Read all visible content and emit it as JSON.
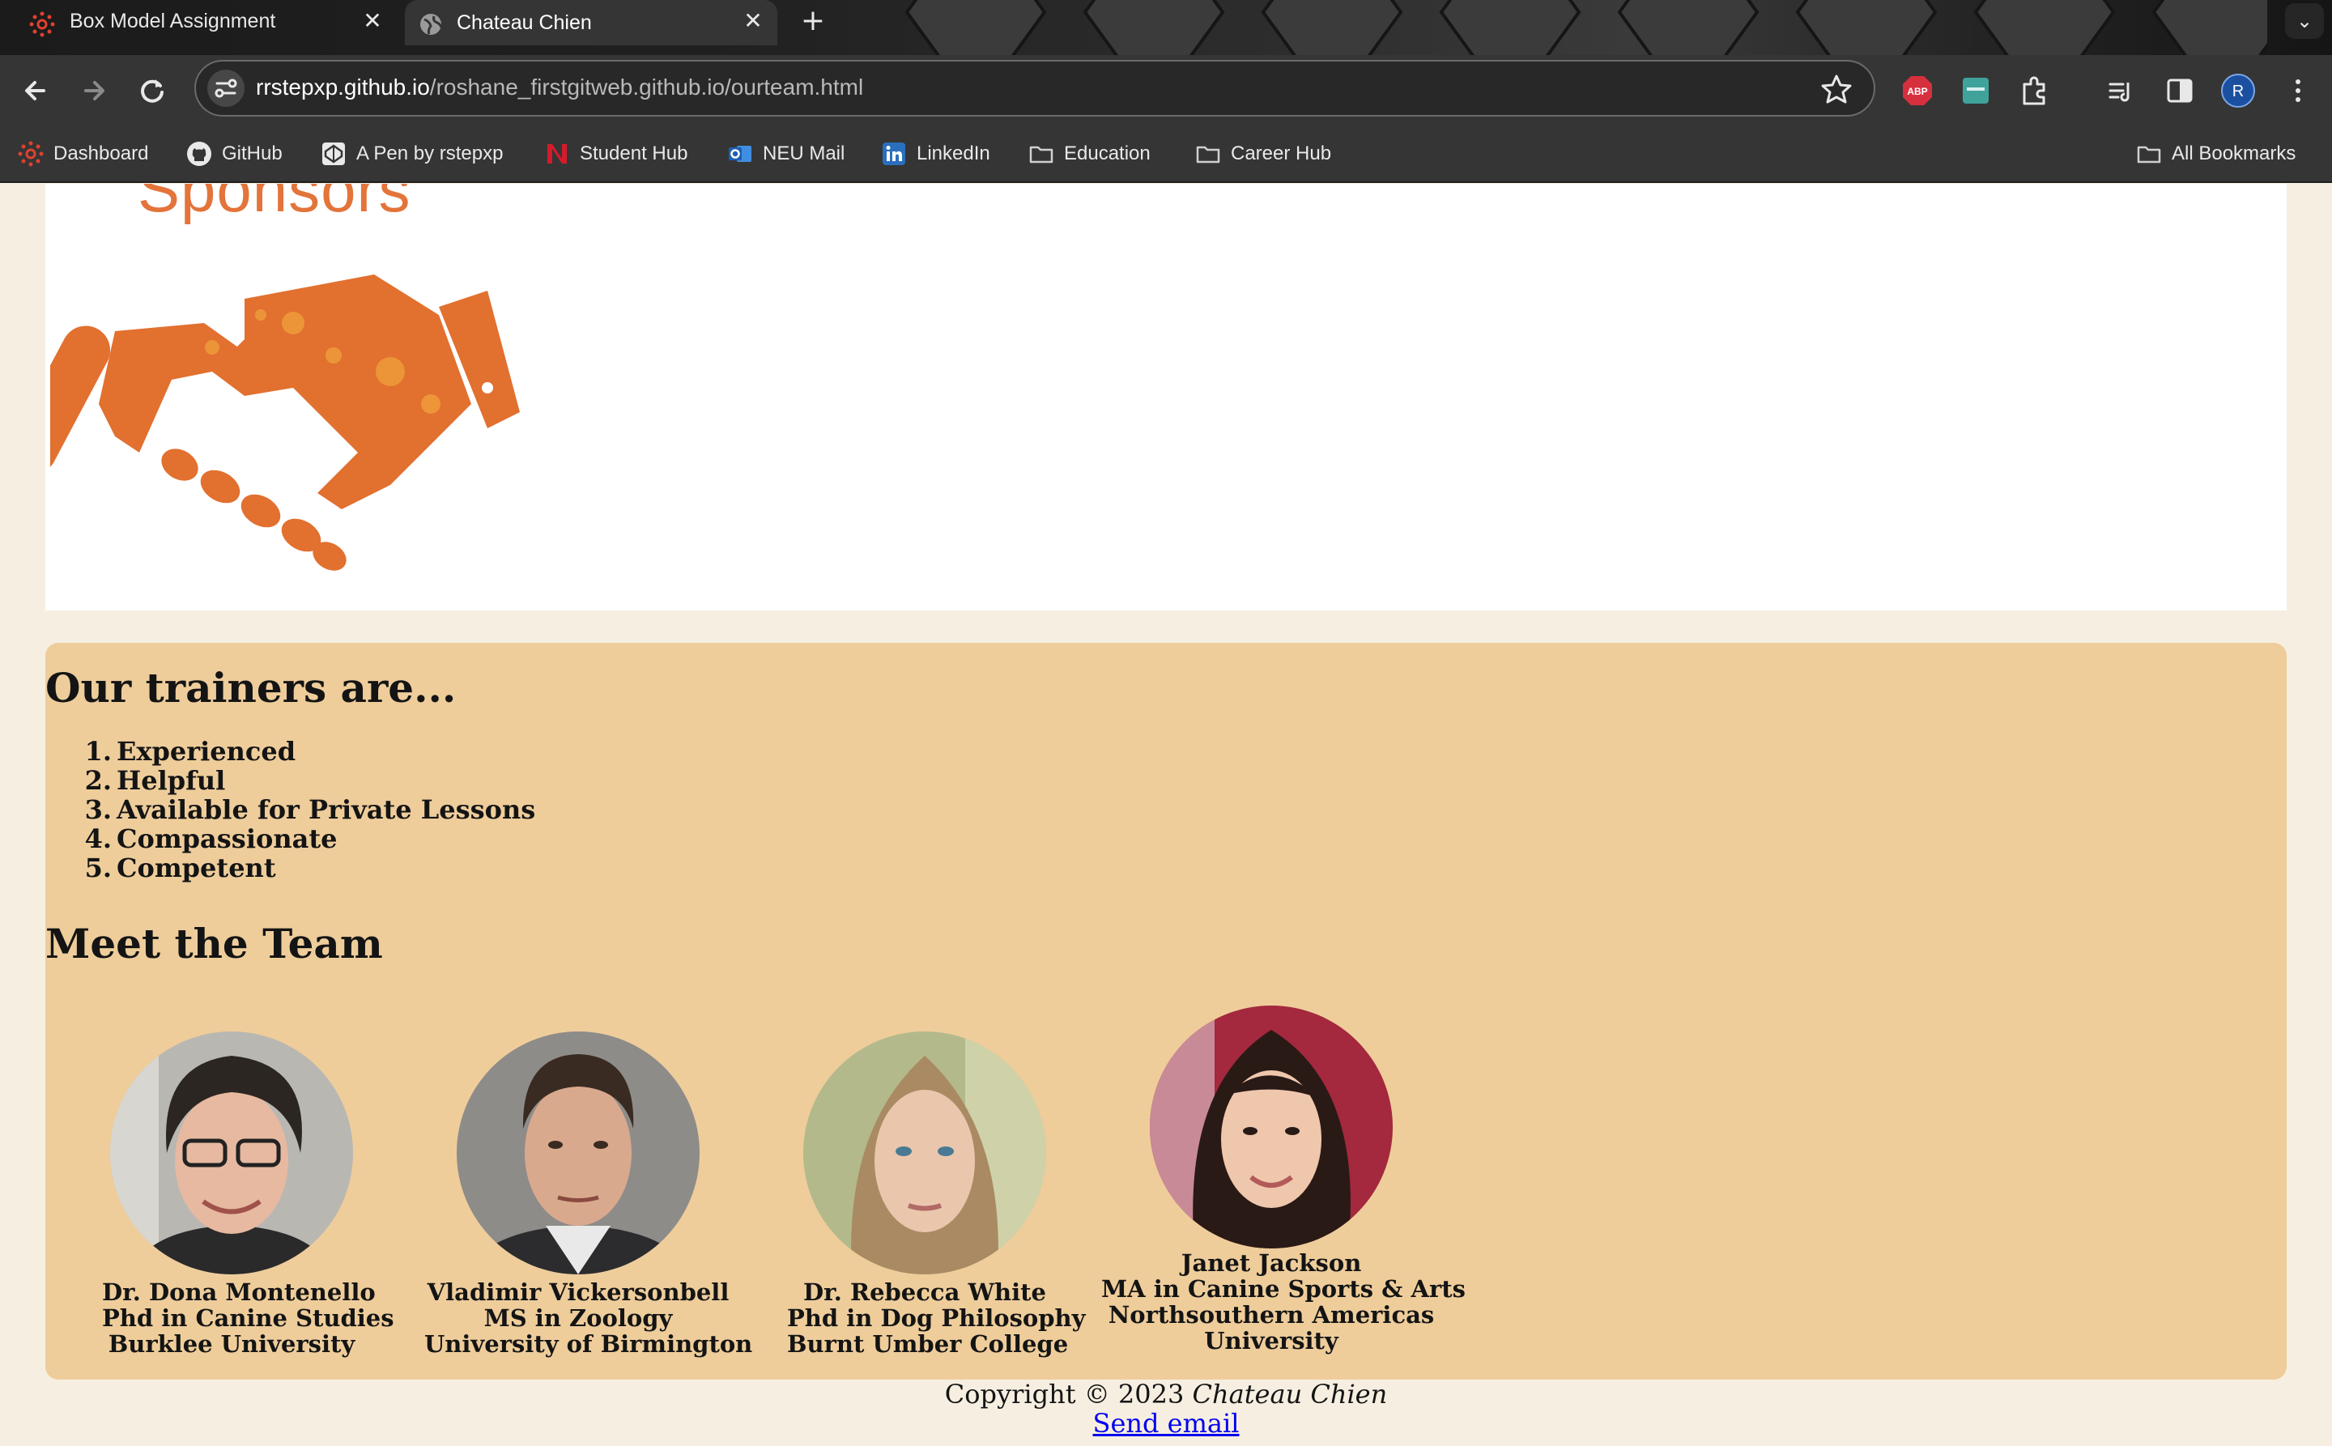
{
  "browser": {
    "tabs": [
      {
        "title": "Box Model Assignment",
        "active": false,
        "favicon": "canvas-logo-icon"
      },
      {
        "title": "Chateau Chien",
        "active": true,
        "favicon": "globe-icon"
      }
    ],
    "url_host": "rrstepxp.github.io",
    "url_path": "/roshane_firstgitweb.github.io/ourteam.html",
    "profile_initial": "R",
    "extensions": [
      "adblock-icon",
      "extension-icon",
      "puzzle-icon",
      "reading-list-icon",
      "side-panel-icon"
    ],
    "bookmarks": [
      {
        "label": "Dashboard",
        "icon": "canvas-logo-icon"
      },
      {
        "label": "GitHub",
        "icon": "github-icon"
      },
      {
        "label": "A Pen by rstepxp",
        "icon": "codepen-icon"
      },
      {
        "label": "Student Hub",
        "icon": "northeastern-icon"
      },
      {
        "label": "NEU Mail",
        "icon": "outlook-icon"
      },
      {
        "label": "LinkedIn",
        "icon": "linkedin-icon"
      },
      {
        "label": "Education",
        "icon": "folder-icon"
      },
      {
        "label": "Career Hub",
        "icon": "folder-icon"
      }
    ],
    "all_bookmarks": "All Bookmarks",
    "abp_badge": "ABP"
  },
  "page": {
    "sponsors_heading": "Sponsors",
    "trainers_heading": "Our trainers are...",
    "qualities": [
      "Experienced",
      "Helpful",
      "Available for Private Lessons",
      "Compassionate",
      "Competent"
    ],
    "team_heading": "Meet the Team",
    "team": [
      {
        "name": "Dr. Dona Montenello",
        "degree": "Phd in Canine Studies",
        "school": "Burklee University"
      },
      {
        "name": "Vladimir Vickersonbell",
        "degree": "MS in Zoology",
        "school": "University of Birmington"
      },
      {
        "name": "Dr. Rebecca White",
        "degree": "Phd in Dog Philosophy",
        "school": "Burnt Umber College"
      },
      {
        "name": "Janet Jackson",
        "degree": "MA in Canine Sports & Arts",
        "school": "Northsouthern Americas",
        "school_line2": "University"
      }
    ],
    "copyright_prefix": "Copyright © 2023 ",
    "copyright_brand": "Chateau Chien",
    "email_link": "Send email"
  },
  "colors": {
    "accent_orange": "#e3743a",
    "card_tan": "#eecd9b",
    "page_bg": "#f6efe1",
    "link_blue": "#0000ee"
  }
}
